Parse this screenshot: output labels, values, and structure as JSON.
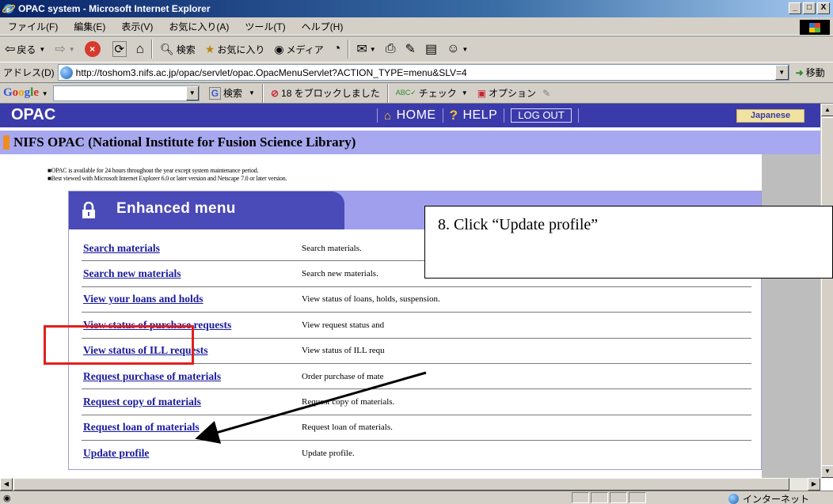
{
  "window": {
    "title": "OPAC system - Microsoft Internet Explorer",
    "minimize": "_",
    "maximize": "□",
    "close": "X"
  },
  "menubar": [
    "ファイル(F)",
    "編集(E)",
    "表示(V)",
    "お気に入り(A)",
    "ツール(T)",
    "ヘルプ(H)"
  ],
  "toolbar": {
    "back": "戻る",
    "search": "検索",
    "favorites": "お気に入り",
    "media": "メディア"
  },
  "address": {
    "label": "アドレス(D)",
    "url": "http://toshom3.nifs.ac.jp/opac/servlet/opac.OpacMenuServlet?ACTION_TYPE=menu&SLV=4",
    "go": "移動"
  },
  "google_toolbar": {
    "logo": "Google",
    "search_value": "",
    "search_button": "検索",
    "popup_blocked": "18 をブロックしました",
    "check": "チェック",
    "options": "オプション"
  },
  "opac": {
    "logo": "OPAC",
    "nav": {
      "home": "HOME",
      "help": "HELP",
      "logout": "LOG OUT"
    },
    "language_button": "Japanese",
    "subtitle": "NIFS OPAC (National Institute for Fusion Science Library)",
    "notes": [
      "■OPAC is available for 24 hours throughout the year except system maintenance period.",
      "■Best viewed with Microsoft Internet Explorer 6.0 or later version and Netscape 7.0 or later version."
    ],
    "menu_title": "Enhanced menu",
    "items": [
      {
        "link": "Search materials",
        "desc": "Search materials."
      },
      {
        "link": "Search new materials",
        "desc": "Search new materials."
      },
      {
        "link": "View your loans and holds",
        "desc": "View status of loans, holds, suspension."
      },
      {
        "link": "View status of purchase requests",
        "desc": "View request status and"
      },
      {
        "link": "View status of ILL requests",
        "desc": "View status of ILL requ"
      },
      {
        "link": "Request purchase of materials",
        "desc": "Order purchase of mate"
      },
      {
        "link": "Request copy of materials",
        "desc": "Request copy of materials."
      },
      {
        "link": "Request loan of materials",
        "desc": "Request loan of materials."
      },
      {
        "link": "Update profile",
        "desc": "Update profile."
      }
    ]
  },
  "annotation": {
    "callout_text": "8. Click “Update profile”",
    "highlight_color": "#e0201c"
  },
  "status": {
    "zone": "インターネット"
  },
  "colors": {
    "opac_bar": "#3a3aaa",
    "subtitle_bar": "#a8a8f0",
    "link": "#1a1a9c",
    "menu_head": "#4a4ab8"
  }
}
